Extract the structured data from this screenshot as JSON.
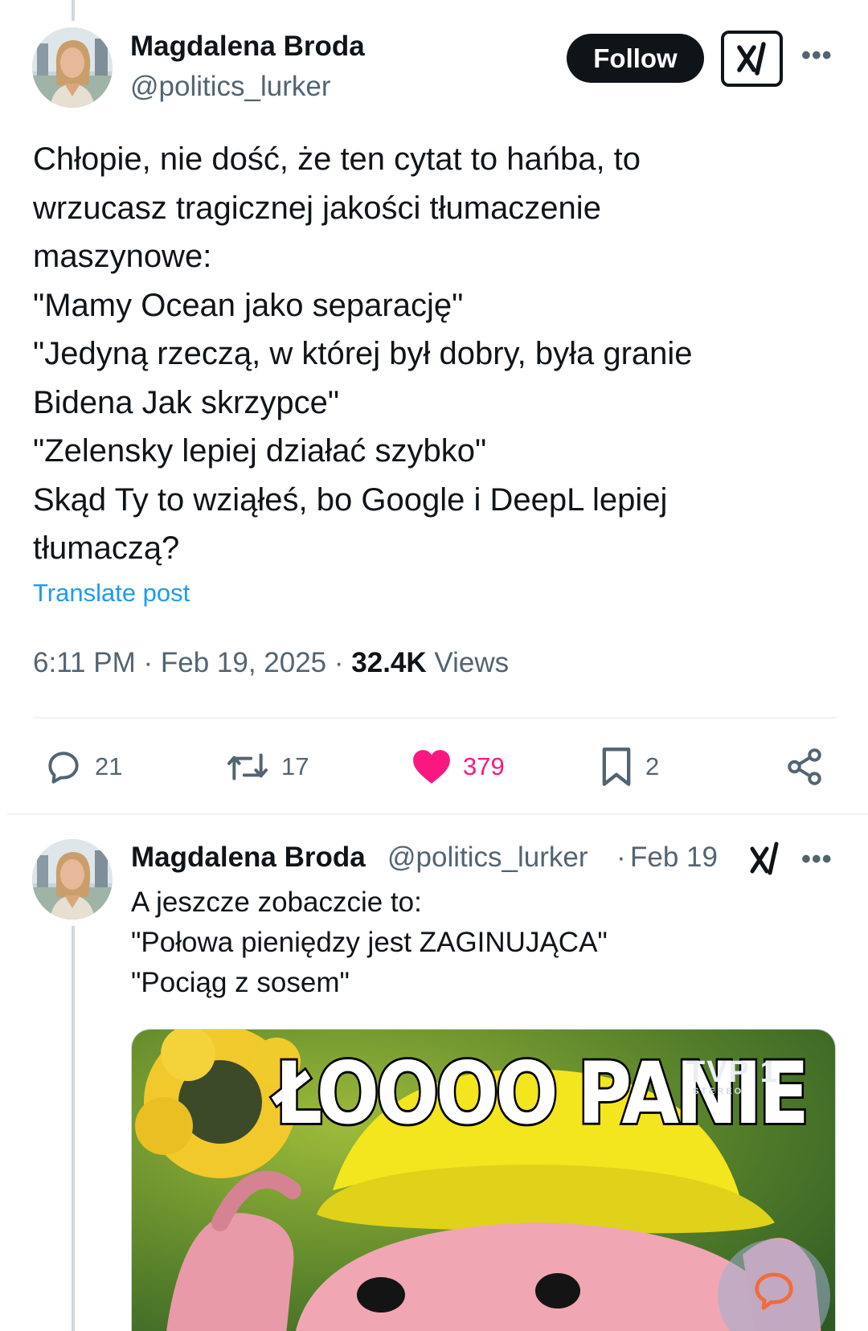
{
  "post": {
    "author_name": "Magdalena Broda",
    "author_handle": "@politics_lurker",
    "follow_label": "Follow",
    "grok_icon": "grok-icon",
    "more_icon": "more-icon",
    "more_label": "•••",
    "body_lines": [
      "Chłopie, nie dość, że ten cytat to hańba, to",
      "wrzucasz tragicznej jakości tłumaczenie",
      "maszynowe:",
      "\"Mamy Ocean jako separację\"",
      "\"Jedyną rzeczą, w której był dobry, była granie",
      "Bidena Jak skrzypce\"",
      "\"Zelensky lepiej działać szybko\"",
      "Skąd Ty to wziąłeś, bo Google i DeepL lepiej",
      "tłumaczą?"
    ],
    "translate_label": "Translate post",
    "time": "6:11 PM",
    "date": "Feb 19, 2025",
    "views_count": "32.4K",
    "views_label": "Views",
    "separator": "·",
    "actions": {
      "replies": "21",
      "reposts": "17",
      "likes": "379",
      "bookmarks": "2"
    },
    "like_color": "#f91880",
    "accent_color": "#1d9bf0"
  },
  "reply": {
    "author_name": "Magdalena Broda",
    "author_handle": "@politics_lurker",
    "date": "Feb 19",
    "separator": "·",
    "more_label": "•••",
    "text_lines": [
      "A jeszcze zobaczcie to:",
      "\"Połowa pieniędzy jest ZAGINUJĄCA\"",
      "\"Pociąg z sosem\""
    ],
    "media": {
      "caption": "ŁOOOO PANIE",
      "channel_logo": "TVP 1",
      "channel_sub": "STEREO"
    }
  }
}
